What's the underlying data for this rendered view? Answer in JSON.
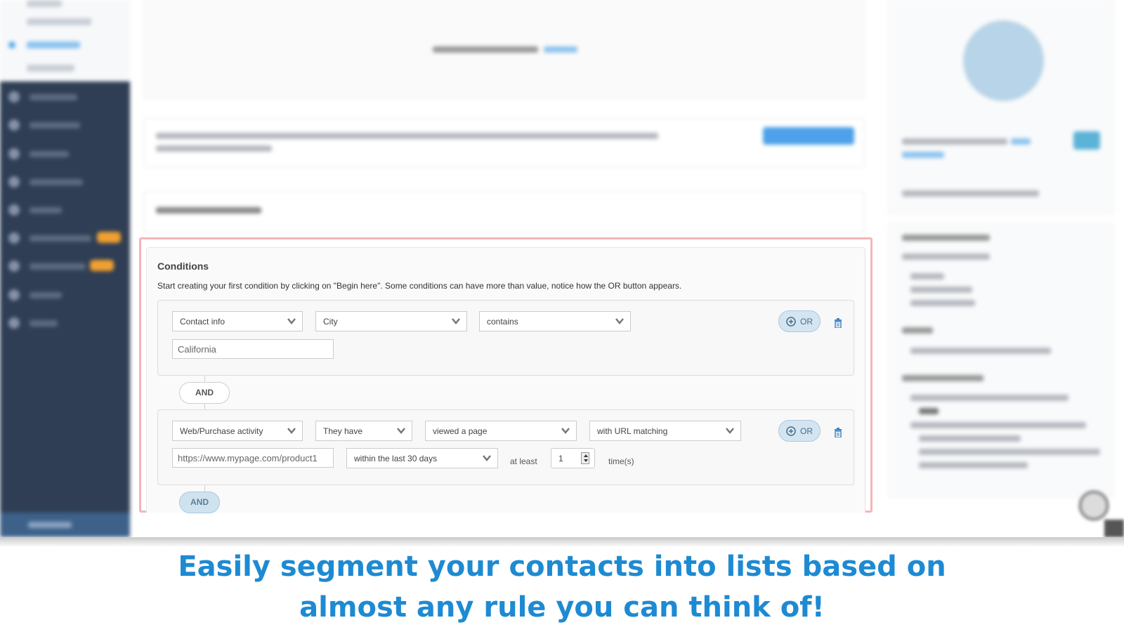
{
  "conditions": {
    "title": "Conditions",
    "description": "Start creating your first condition by clicking on \"Begin here\". Some conditions can have more than value, notice how the OR button appears.",
    "groups": [
      {
        "selects": [
          "Contact info",
          "City",
          "contains"
        ],
        "value_input": "California",
        "or_label": "OR"
      },
      {
        "selects": [
          "Web/Purchase activity",
          "They have",
          "viewed a page",
          "with URL matching"
        ],
        "url_input": "https://www.mypage.com/product1",
        "timeframe_select": "within the last 30 days",
        "at_least_label": "at least",
        "count_value": "1",
        "times_label": "time(s)",
        "or_label": "OR"
      }
    ],
    "and_labels": [
      "AND",
      "AND"
    ]
  },
  "caption": {
    "line1": "Easily segment your contacts into lists based on",
    "line2": "almost any rule you can think of!"
  },
  "colors": {
    "caption": "#1e8ad2",
    "highlight_border": "#f5b5b8",
    "sidebar": "#2f3e55",
    "badge": "#f0a030"
  }
}
